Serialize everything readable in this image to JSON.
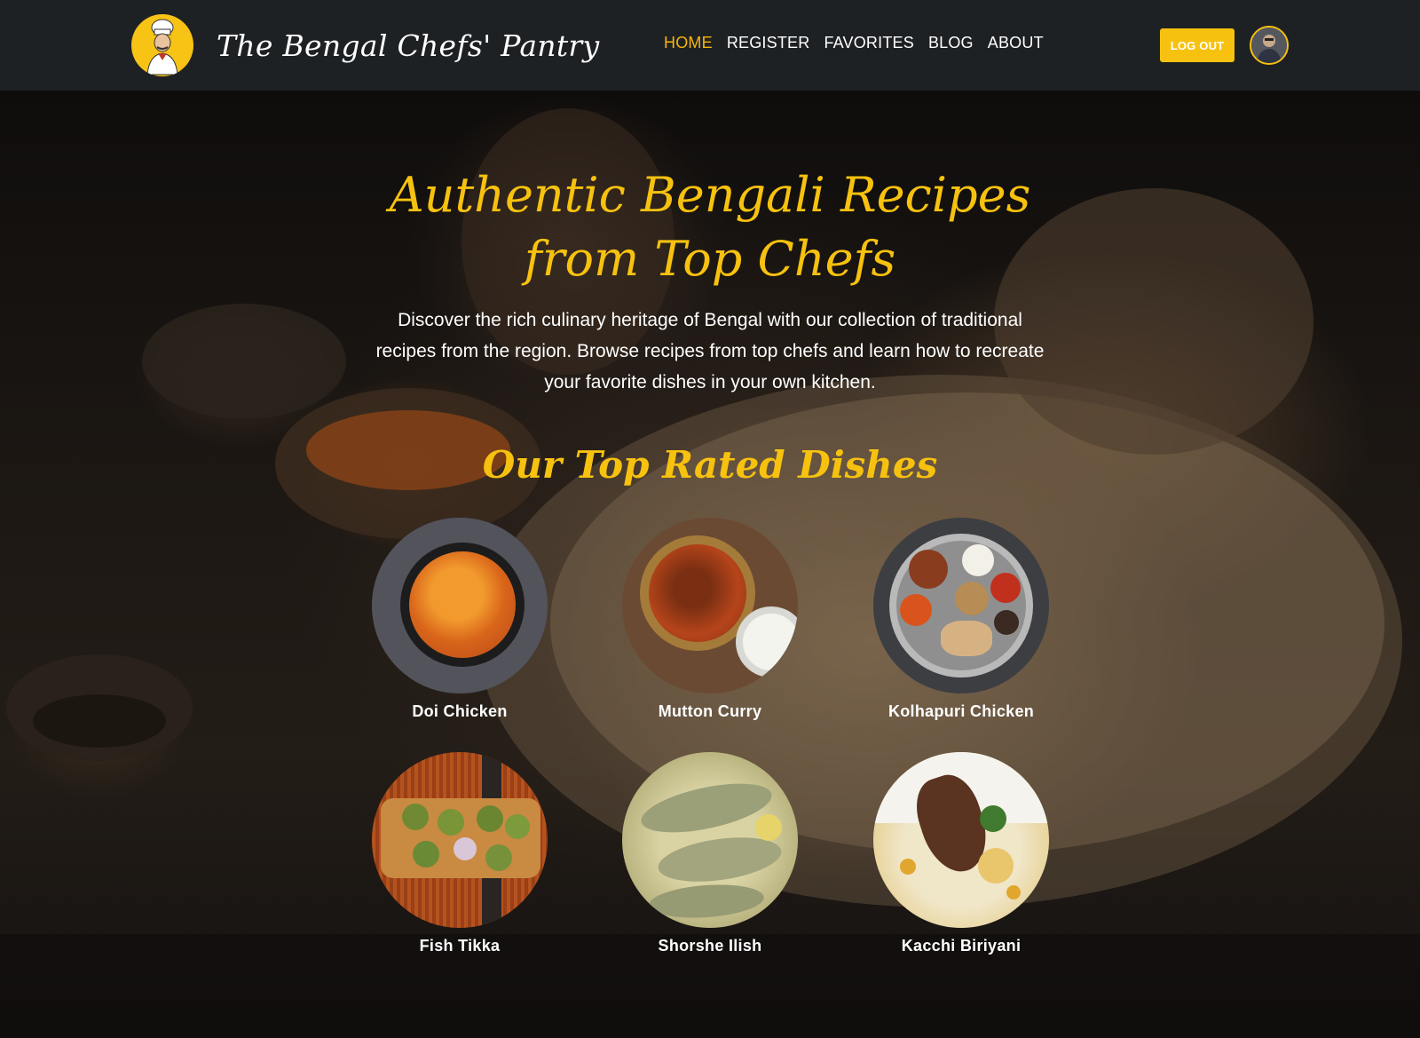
{
  "header": {
    "brand_name": "The Bengal Chefs' Pantry",
    "nav": [
      {
        "label": "HOME",
        "active": true
      },
      {
        "label": "REGISTER"
      },
      {
        "label": "FAVORITES"
      },
      {
        "label": "BLOG"
      },
      {
        "label": "ABOUT"
      }
    ],
    "logout_label": "LOG OUT",
    "accent_color": "#f7c20f"
  },
  "hero": {
    "title_line1": "Authentic Bengali Recipes",
    "title_line2": "from Top Chefs",
    "description": "Discover the rich culinary heritage of Bengal with our collection of traditional recipes from the region. Browse recipes from top chefs and learn how to recreate your favorite dishes in your own kitchen."
  },
  "top_dishes": {
    "title": "Our Top Rated Dishes",
    "items": [
      {
        "name": "Doi Chicken"
      },
      {
        "name": "Mutton Curry"
      },
      {
        "name": "Kolhapuri Chicken"
      },
      {
        "name": "Fish Tikka"
      },
      {
        "name": "Shorshe Ilish"
      },
      {
        "name": "Kacchi Biriyani"
      }
    ]
  }
}
